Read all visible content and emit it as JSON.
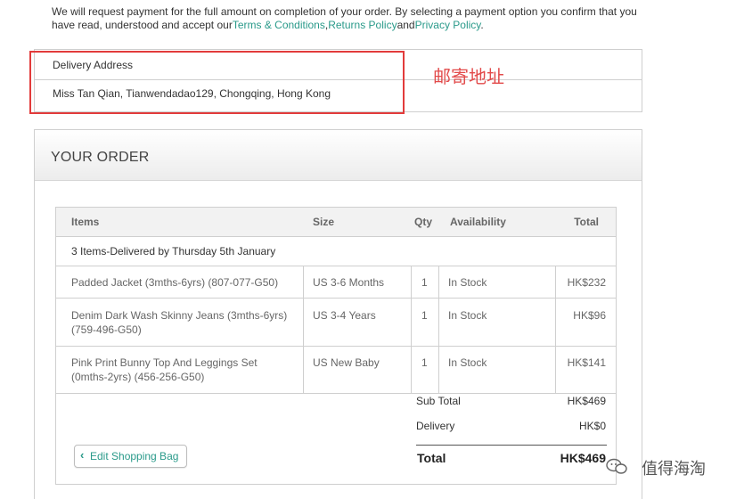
{
  "notice": {
    "text_1": "We will request payment for the full amount on completion of your order. By selecting a payment option you confirm that you have read, understood and accept our",
    "terms_link": "Terms & Conditions",
    "sep": ",",
    "returns_link": "Returns Policy",
    "and_text": "and",
    "privacy_link": "Privacy Policy",
    "end": "."
  },
  "delivery": {
    "label": "Delivery Address",
    "address": "Miss Tan Qian, Tianwendadao129, Chongqing, Hong Kong"
  },
  "annotation": {
    "text": "邮寄地址",
    "color": "#e24a4a"
  },
  "order": {
    "title": "YOUR ORDER",
    "columns": {
      "items": "Items",
      "size": "Size",
      "qty": "Qty",
      "availability": "Availability",
      "total": "Total"
    },
    "delivered_note": "3 Items-Delivered by Thursday 5th January",
    "rows": [
      {
        "item_line1": "Padded Jacket (3mths-6yrs) (807-077-G50)",
        "item_line2": "",
        "size": "US 3-6 Months",
        "qty": "1",
        "availability": "In Stock",
        "total": "HK$232"
      },
      {
        "item_line1": "Denim Dark Wash Skinny Jeans (3mths-6yrs)",
        "item_line2": "(759-496-G50)",
        "size": "US 3-4 Years",
        "qty": "1",
        "availability": "In Stock",
        "total": "HK$96"
      },
      {
        "item_line1": "Pink Print Bunny Top And Leggings Set",
        "item_line2": "(0mths-2yrs) (456-256-G50)",
        "size": "US New Baby",
        "qty": "1",
        "availability": "In Stock",
        "total": "HK$141"
      }
    ],
    "summary": {
      "subtotal_label": "Sub Total",
      "subtotal_value": "HK$469",
      "delivery_label": "Delivery",
      "delivery_value": "HK$0",
      "total_label": "Total",
      "total_value": "HK$469"
    },
    "edit_button": {
      "icon": "chevron-left-icon",
      "label": "Edit Shopping Bag"
    }
  },
  "watermark": {
    "icon": "chat-bubble-icon",
    "text": "值得海淘"
  },
  "colors": {
    "link": "#2a9a8a",
    "annotation_frame": "#e23b3b",
    "border": "#cfcfcf"
  }
}
